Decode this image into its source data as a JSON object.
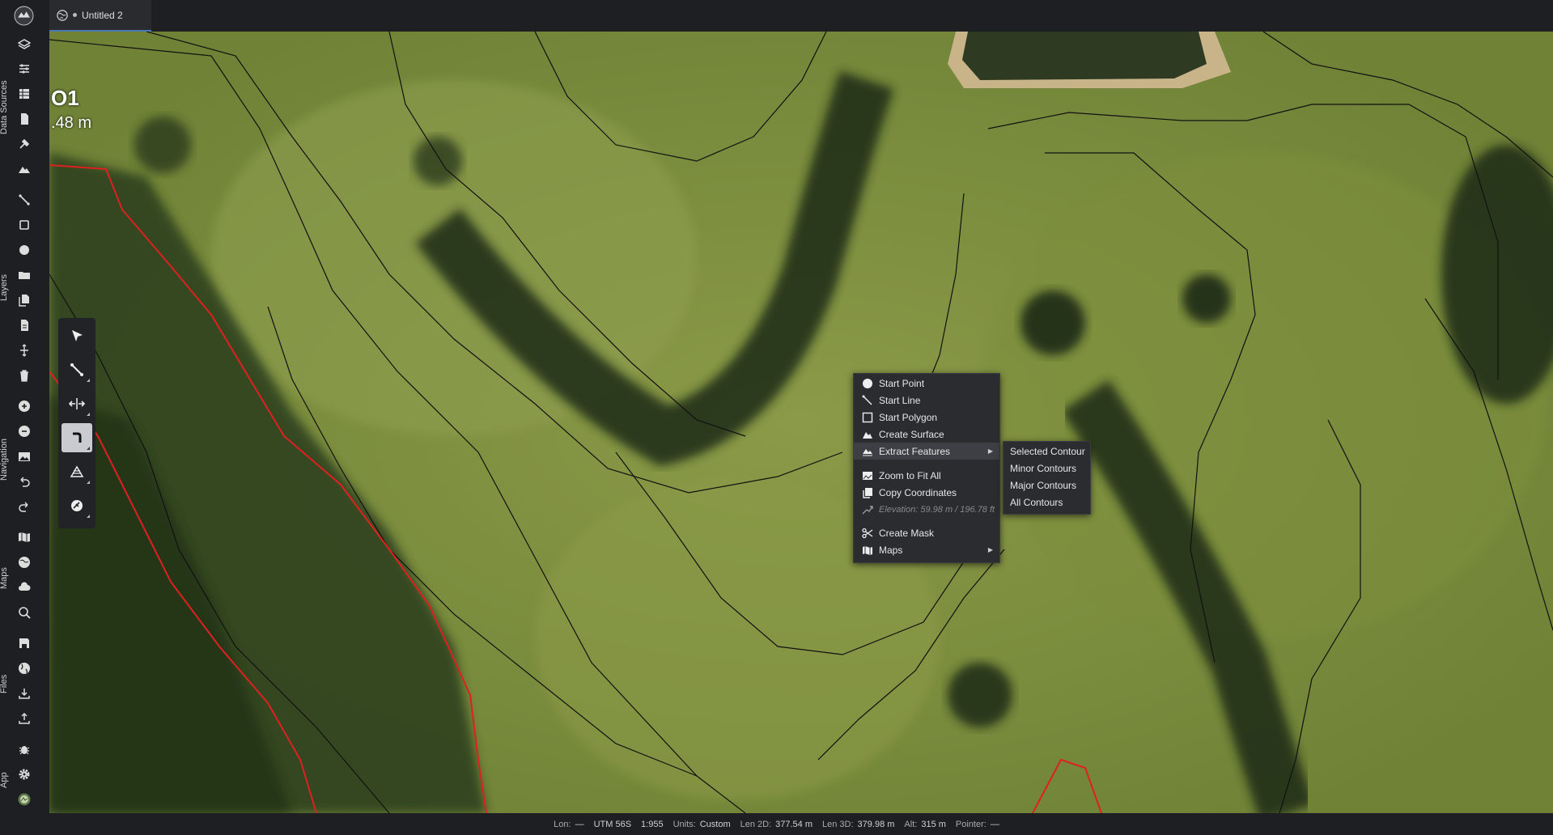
{
  "app": {
    "logo_icon": "app-logo-icon"
  },
  "tab": {
    "title": "Untitled 2",
    "icon": "globe-icon"
  },
  "sidebar": {
    "sections": [
      {
        "label": "Data Sources"
      },
      {
        "label": "Layers"
      },
      {
        "label": "Navigation"
      },
      {
        "label": "Maps"
      },
      {
        "label": "Files"
      },
      {
        "label": "App"
      }
    ],
    "icons": [
      "layers-icon",
      "sliders-icon",
      "table-icon",
      "document-icon",
      "satellite-icon",
      "terrain-icon",
      "line-tool-icon",
      "square-icon",
      "circle-icon",
      "folder-icon",
      "copy-icon",
      "file-icon",
      "split-icon",
      "trash-icon",
      "zoom-in-icon",
      "zoom-out-icon",
      "image-icon",
      "undo-icon",
      "redo-icon",
      "map-icon",
      "globe-icon",
      "cloud-icon",
      "search-icon",
      "save-icon",
      "earth-icon",
      "download-icon",
      "upload-icon",
      "bug-icon",
      "gear-icon",
      "avatar-icon"
    ]
  },
  "overlay": {
    "title": "O1",
    "subtitle": ".48 m"
  },
  "toolbar": {
    "tools": [
      {
        "name": "select-tool"
      },
      {
        "name": "line-tool"
      },
      {
        "name": "split-tool"
      },
      {
        "name": "corner-tool",
        "active": true
      },
      {
        "name": "mask-tool"
      },
      {
        "name": "measure-tool"
      }
    ]
  },
  "context_menu": {
    "items": [
      {
        "label": "Start Point",
        "icon": "circle-icon"
      },
      {
        "label": "Start Line",
        "icon": "line-icon"
      },
      {
        "label": "Start Polygon",
        "icon": "square-icon"
      },
      {
        "label": "Create Surface",
        "icon": "terrain-icon"
      },
      {
        "label": "Extract Features",
        "icon": "extract-icon",
        "submenu": true,
        "highlighted": true
      },
      {
        "label": "Zoom to Fit All",
        "icon": "zoom-fit-icon"
      },
      {
        "label": "Copy Coordinates",
        "icon": "copy-icon"
      },
      {
        "label": "Elevation: 59.98 m / 196.78 ft",
        "icon": "elevation-icon",
        "disabled": true
      },
      {
        "label": "Create Mask",
        "icon": "scissors-icon"
      },
      {
        "label": "Maps",
        "icon": "map-icon",
        "submenu": true
      }
    ]
  },
  "submenu": {
    "items": [
      {
        "label": "Selected Contour"
      },
      {
        "label": "Minor Contours"
      },
      {
        "label": "Major Contours"
      },
      {
        "label": "All Contours"
      }
    ]
  },
  "status": {
    "lon_label": "Lon:",
    "lon_value": "—",
    "utm": "UTM 56S",
    "scale": "1:955",
    "units_label": "Units:",
    "units_value": "Custom",
    "len2d_label": "Len 2D:",
    "len2d_value": "377.54 m",
    "len3d_label": "Len 3D:",
    "len3d_value": "379.98 m",
    "alt_label": "Alt:",
    "alt_value": "315 m",
    "pointer_label": "Pointer:",
    "pointer_value": "—"
  },
  "colors": {
    "background": "#1e1f22",
    "menu": "#2b2c30",
    "accent": "#4a78b5",
    "boundary": "#e02020",
    "contour": "#111111"
  }
}
